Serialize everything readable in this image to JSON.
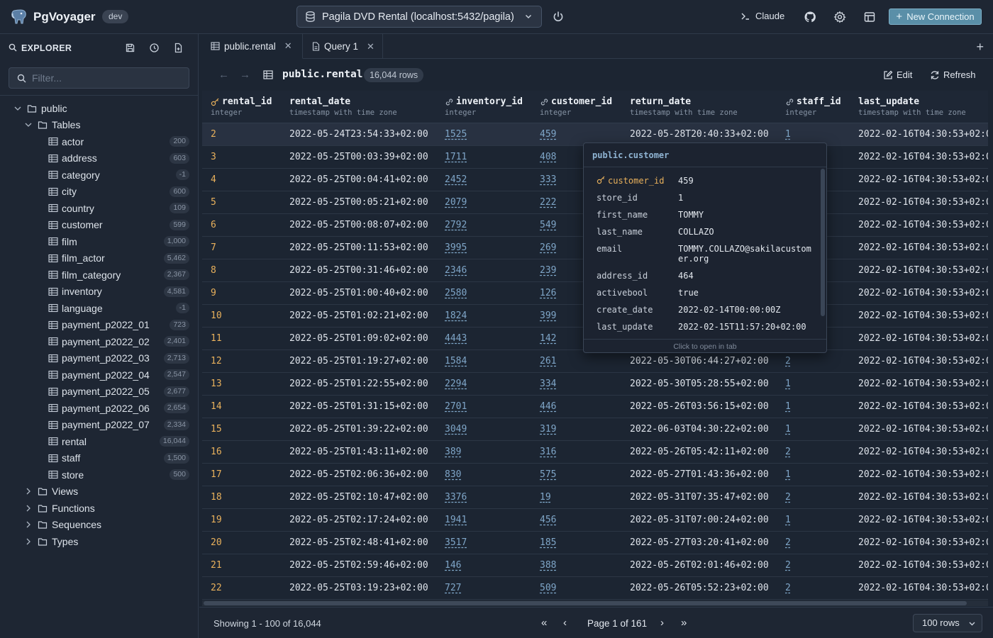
{
  "header": {
    "app_name": "PgVoyager",
    "env_badge": "dev",
    "connection": "Pagila DVD Rental (localhost:5432/pagila)",
    "claude_label": "Claude",
    "new_connection_label": "New Connection"
  },
  "sidebar": {
    "title": "EXPLORER",
    "filter_placeholder": "Filter...",
    "schema": "public",
    "tables_label": "Tables",
    "tables": [
      {
        "name": "actor",
        "count": "200"
      },
      {
        "name": "address",
        "count": "603"
      },
      {
        "name": "category",
        "count": "-1"
      },
      {
        "name": "city",
        "count": "600"
      },
      {
        "name": "country",
        "count": "109"
      },
      {
        "name": "customer",
        "count": "599"
      },
      {
        "name": "film",
        "count": "1,000"
      },
      {
        "name": "film_actor",
        "count": "5,462"
      },
      {
        "name": "film_category",
        "count": "2,367"
      },
      {
        "name": "inventory",
        "count": "4,581"
      },
      {
        "name": "language",
        "count": "-1"
      },
      {
        "name": "payment_p2022_01",
        "count": "723"
      },
      {
        "name": "payment_p2022_02",
        "count": "2,401"
      },
      {
        "name": "payment_p2022_03",
        "count": "2,713"
      },
      {
        "name": "payment_p2022_04",
        "count": "2,547"
      },
      {
        "name": "payment_p2022_05",
        "count": "2,677"
      },
      {
        "name": "payment_p2022_06",
        "count": "2,654"
      },
      {
        "name": "payment_p2022_07",
        "count": "2,334"
      },
      {
        "name": "rental",
        "count": "16,044"
      },
      {
        "name": "staff",
        "count": "1,500"
      },
      {
        "name": "store",
        "count": "500"
      }
    ],
    "other_groups": [
      "Views",
      "Functions",
      "Sequences",
      "Types"
    ]
  },
  "tabs": [
    {
      "label": "public.rental"
    },
    {
      "label": "Query 1"
    }
  ],
  "toolbar": {
    "table_name": "public.rental",
    "rows_badge": "16,044 rows",
    "edit_label": "Edit",
    "refresh_label": "Refresh"
  },
  "grid": {
    "columns": [
      {
        "name": "rental_id",
        "type": "integer",
        "icon": "key-icon"
      },
      {
        "name": "rental_date",
        "type": "timestamp with time zone",
        "icon": ""
      },
      {
        "name": "inventory_id",
        "type": "integer",
        "icon": "link-icon"
      },
      {
        "name": "customer_id",
        "type": "integer",
        "icon": "link-icon"
      },
      {
        "name": "return_date",
        "type": "timestamp with time zone",
        "icon": ""
      },
      {
        "name": "staff_id",
        "type": "integer",
        "icon": "link-icon"
      },
      {
        "name": "last_update",
        "type": "timestamp with time zone",
        "icon": ""
      }
    ],
    "rows": [
      [
        "2",
        "2022-05-24T23:54:33+02:00",
        "1525",
        "459",
        "2022-05-28T20:40:33+02:00",
        "1",
        "2022-02-16T04:30:53+02:00"
      ],
      [
        "3",
        "2022-05-25T00:03:39+02:00",
        "1711",
        "408",
        "",
        "",
        "2022-02-16T04:30:53+02:00"
      ],
      [
        "4",
        "2022-05-25T00:04:41+02:00",
        "2452",
        "333",
        "",
        "",
        "2022-02-16T04:30:53+02:00"
      ],
      [
        "5",
        "2022-05-25T00:05:21+02:00",
        "2079",
        "222",
        "",
        "",
        "2022-02-16T04:30:53+02:00"
      ],
      [
        "6",
        "2022-05-25T00:08:07+02:00",
        "2792",
        "549",
        "",
        "",
        "2022-02-16T04:30:53+02:00"
      ],
      [
        "7",
        "2022-05-25T00:11:53+02:00",
        "3995",
        "269",
        "",
        "",
        "2022-02-16T04:30:53+02:00"
      ],
      [
        "8",
        "2022-05-25T00:31:46+02:00",
        "2346",
        "239",
        "",
        "",
        "2022-02-16T04:30:53+02:00"
      ],
      [
        "9",
        "2022-05-25T01:00:40+02:00",
        "2580",
        "126",
        "",
        "",
        "2022-02-16T04:30:53+02:00"
      ],
      [
        "10",
        "2022-05-25T01:02:21+02:00",
        "1824",
        "399",
        "",
        "",
        "2022-02-16T04:30:53+02:00"
      ],
      [
        "11",
        "2022-05-25T01:09:02+02:00",
        "4443",
        "142",
        "",
        "",
        "2022-02-16T04:30:53+02:00"
      ],
      [
        "12",
        "2022-05-25T01:19:27+02:00",
        "1584",
        "261",
        "2022-05-30T06:44:27+02:00",
        "2",
        "2022-02-16T04:30:53+02:00"
      ],
      [
        "13",
        "2022-05-25T01:22:55+02:00",
        "2294",
        "334",
        "2022-05-30T05:28:55+02:00",
        "1",
        "2022-02-16T04:30:53+02:00"
      ],
      [
        "14",
        "2022-05-25T01:31:15+02:00",
        "2701",
        "446",
        "2022-05-26T03:56:15+02:00",
        "1",
        "2022-02-16T04:30:53+02:00"
      ],
      [
        "15",
        "2022-05-25T01:39:22+02:00",
        "3049",
        "319",
        "2022-06-03T04:30:22+02:00",
        "1",
        "2022-02-16T04:30:53+02:00"
      ],
      [
        "16",
        "2022-05-25T01:43:11+02:00",
        "389",
        "316",
        "2022-05-26T05:42:11+02:00",
        "2",
        "2022-02-16T04:30:53+02:00"
      ],
      [
        "17",
        "2022-05-25T02:06:36+02:00",
        "830",
        "575",
        "2022-05-27T01:43:36+02:00",
        "1",
        "2022-02-16T04:30:53+02:00"
      ],
      [
        "18",
        "2022-05-25T02:10:47+02:00",
        "3376",
        "19",
        "2022-05-31T07:35:47+02:00",
        "2",
        "2022-02-16T04:30:53+02:00"
      ],
      [
        "19",
        "2022-05-25T02:17:24+02:00",
        "1941",
        "456",
        "2022-05-31T07:00:24+02:00",
        "1",
        "2022-02-16T04:30:53+02:00"
      ],
      [
        "20",
        "2022-05-25T02:48:41+02:00",
        "3517",
        "185",
        "2022-05-27T03:20:41+02:00",
        "2",
        "2022-02-16T04:30:53+02:00"
      ],
      [
        "21",
        "2022-05-25T02:59:46+02:00",
        "146",
        "388",
        "2022-05-26T02:01:46+02:00",
        "2",
        "2022-02-16T04:30:53+02:00"
      ],
      [
        "22",
        "2022-05-25T03:19:23+02:00",
        "727",
        "509",
        "2022-05-26T05:52:23+02:00",
        "2",
        "2022-02-16T04:30:53+02:00"
      ]
    ]
  },
  "popover": {
    "title": "public.customer",
    "fields": [
      {
        "key": "customer_id",
        "value": "459",
        "pk": true
      },
      {
        "key": "store_id",
        "value": "1"
      },
      {
        "key": "first_name",
        "value": "TOMMY"
      },
      {
        "key": "last_name",
        "value": "COLLAZO"
      },
      {
        "key": "email",
        "value": "TOMMY.COLLAZO@sakilacustomer.org"
      },
      {
        "key": "address_id",
        "value": "464"
      },
      {
        "key": "activebool",
        "value": "true"
      },
      {
        "key": "create_date",
        "value": "2022-02-14T00:00:00Z"
      },
      {
        "key": "last_update",
        "value": "2022-02-15T11:57:20+02:00"
      }
    ],
    "footer": "Click to open in tab"
  },
  "footer": {
    "showing": "Showing 1 - 100 of 16,044",
    "page_label": "Page 1 of 161",
    "rows_per_page": "100 rows"
  }
}
